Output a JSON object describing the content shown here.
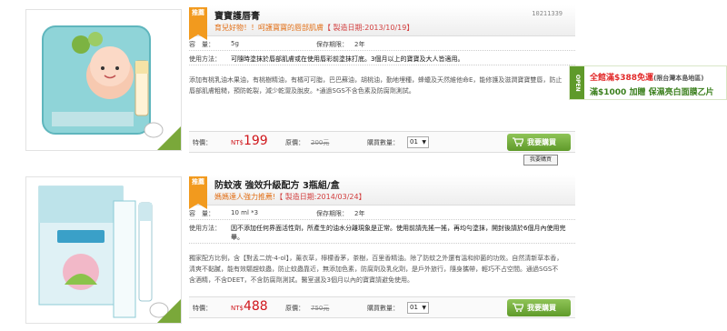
{
  "products": [
    {
      "ribbon": "推薦",
      "title": "寶寶護唇膏",
      "subtitle": "育兒好物！！呵護寶寶的唇部肌膚",
      "date_label": "【 製造日期:2013/10/19】",
      "sku": "10211339",
      "volume_label": "容　量：",
      "volume": "5g",
      "shelf_label": "保存期限：",
      "shelf": "2年",
      "usage_label": "使用方法：",
      "usage": "可隨時塗抹於唇部肌膚或在使用唇彩前塗抹打底。3個月以上的寶寶及大人皆適用。",
      "description": "添加有桃乳油木果油，有桃樹精油，有橘可可脂，巴巴蘇油，胡桃油，勤地埋種，蜂蠟及天然維他命E，能修護及滋潤寶寶雙唇，防止唇部肌膚粗糙，預防乾裂，減少乾澀及脫皮。*通過SGS不含色素及防腐劑測試。",
      "special_label": "特價：",
      "currency": "NT$",
      "price": "199",
      "orig_label": "原價：",
      "orig_price": "200元",
      "qty_label": "購買數量：",
      "qty": "01",
      "buy_label": "我要購買",
      "tooltip": "我要購買"
    },
    {
      "ribbon": "推薦",
      "title": "防蚊液 強效升級配方 3瓶組/盒",
      "subtitle": "媽媽達人強力推薦!",
      "date_label": "【 製造日期:2014/03/24】",
      "volume_label": "容　量：",
      "volume": "10 ml *3",
      "shelf_label": "保存期限：",
      "shelf": "2年",
      "usage_label": "使用方法：",
      "usage": "因不添加任何界面活性劑，所產生的油水分離現象是正常。使用前請先搖一搖，再均勻塗抹，開封後請於6個月內使用完畢。",
      "description": "獨家配方比例，含【對孟二烷-4-ol】，薰衣草，檸檬香茅，茶樹，百里香精油。除了防蚊之外還有溫和抑菌的功效。自然清新草本香，清爽不黏膩，能有效驅趕蚊蟲，防止蚊蟲靠近，無添加色素，防腐劑及乳化劑，是戶外旅行，隨身攜帶，輕巧不占空間。通過SGS不含酒精，不含DEET，不含防腐劑測試。醫室選及3個月以內的寶寶請避免使用。",
      "special_label": "特價：",
      "currency": "NT$",
      "price": "488",
      "orig_label": "原價：",
      "orig_price": "750元",
      "qty_label": "購買數量：",
      "qty": "01",
      "buy_label": "我要購買"
    }
  ],
  "side_banner": {
    "tab": "OPEN",
    "line1": "全館滿$388免運",
    "line1_note": "(限台灣本島地區)",
    "line2": "滿$1000 加贈 保濕亮白面膜乙片"
  },
  "colors": {
    "accent_orange": "#f29a1e",
    "price_red": "#d0161b",
    "buy_green": "#5f9a2a"
  },
  "icons": [
    "cart-icon",
    "dropdown-arrow-icon"
  ]
}
